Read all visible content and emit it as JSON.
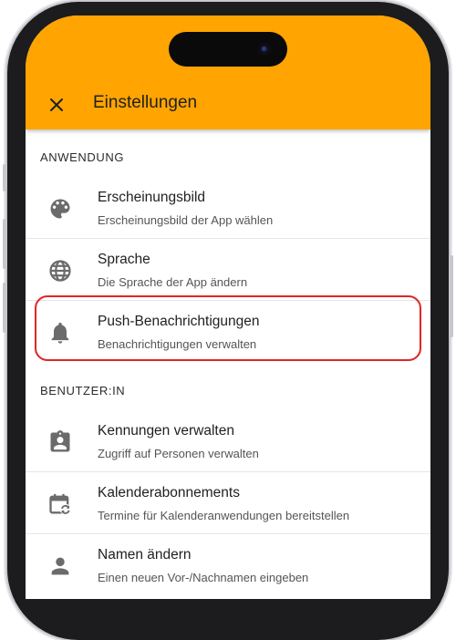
{
  "appbar": {
    "title": "Einstellungen",
    "close_icon": "close-icon",
    "background": "#ffa400"
  },
  "sections": [
    {
      "header": "ANWENDUNG",
      "items": [
        {
          "title": "Erscheinungsbild",
          "subtitle": "Erscheinungsbild der App wählen",
          "icon": "palette-icon"
        },
        {
          "title": "Sprache",
          "subtitle": "Die Sprache der App ändern",
          "icon": "globe-icon"
        },
        {
          "title": "Push-Benachrichtigungen",
          "subtitle": "Benachrichtigungen verwalten",
          "icon": "bell-icon",
          "highlighted": true
        }
      ]
    },
    {
      "header": "BENUTZER:IN",
      "items": [
        {
          "title": "Kennungen verwalten",
          "subtitle": "Zugriff auf Personen verwalten",
          "icon": "badge-icon"
        },
        {
          "title": "Kalenderabonnements",
          "subtitle": "Termine für Kalenderanwendungen bereitstellen",
          "icon": "calendar-sync-icon"
        },
        {
          "title": "Namen ändern",
          "subtitle": "Einen neuen Vor-/Nachnamen eingeben",
          "icon": "person-icon"
        }
      ]
    }
  ],
  "highlight_color": "#e02424"
}
